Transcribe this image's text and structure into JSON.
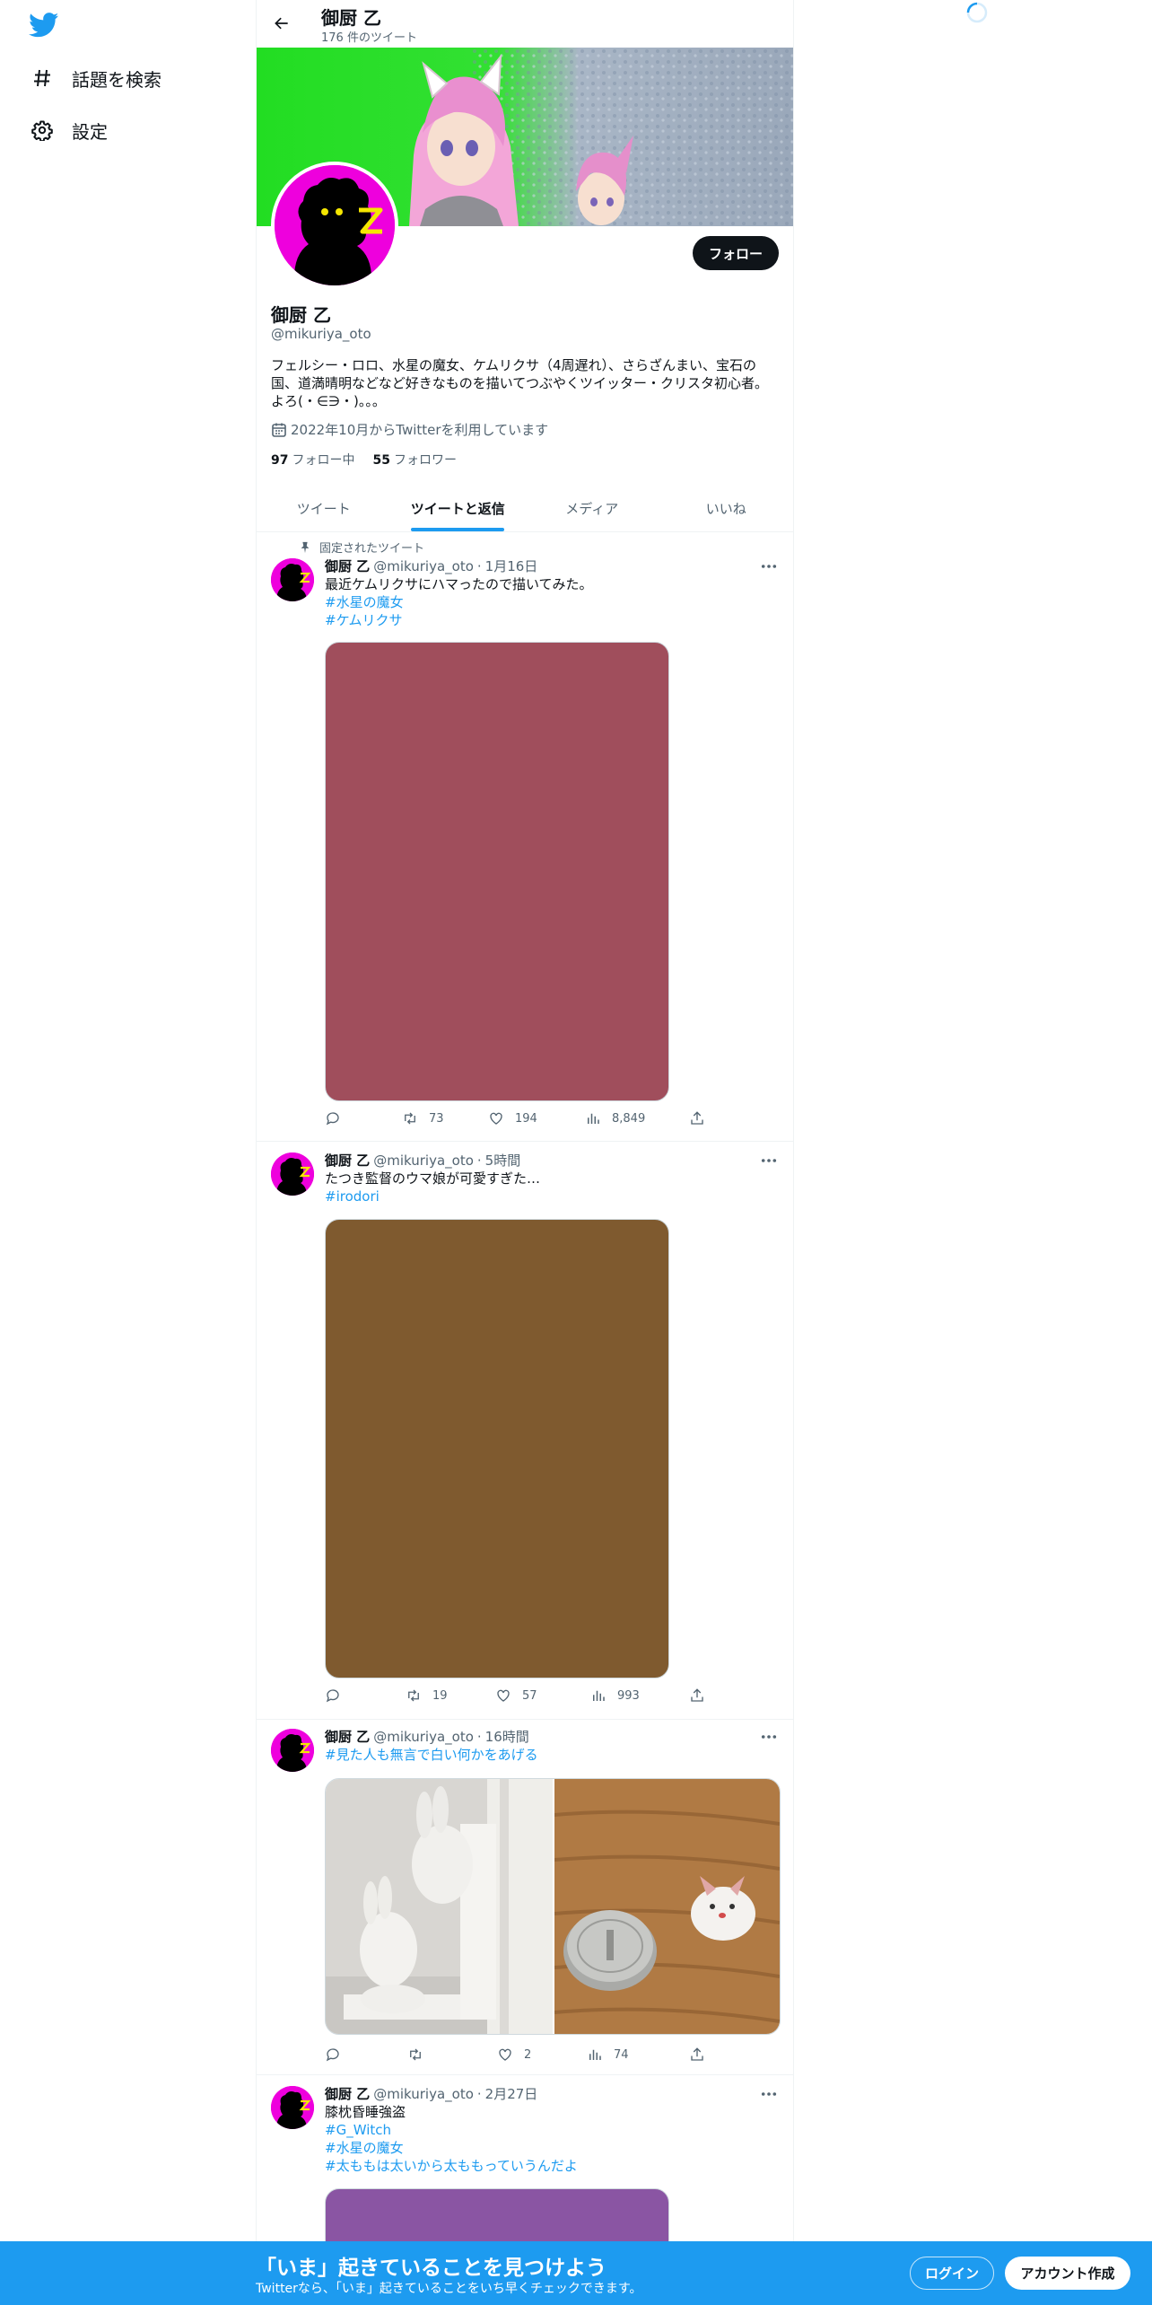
{
  "nav": {
    "items": [
      {
        "label": "話題を検索",
        "icon": "hashtag-icon"
      },
      {
        "label": "設定",
        "icon": "gear-icon"
      }
    ]
  },
  "header": {
    "title": "御厨 乙",
    "tweet_count": "176 件のツイート"
  },
  "profile": {
    "name": "御厨 乙",
    "handle": "@mikuriya_oto",
    "bio": "フェルシー・ロロ、水星の魔女、ケムリクサ（4周遅れ）、さらざんまい、宝石の国、道満晴明などなど好きなものを描いてつぶやくツイッター・クリスタ初心者。よろ(・∈∋・)。。。",
    "joined": "2022年10月からTwitterを利用しています",
    "following_count": "97",
    "following_label": "フォロー中",
    "followers_count": "55",
    "followers_label": "フォロワー",
    "follow_button": "フォロー",
    "accent_color": "#1d9bf0"
  },
  "tabs": [
    {
      "label": "ツイート",
      "active": false
    },
    {
      "label": "ツイートと返信",
      "active": true
    },
    {
      "label": "メディア",
      "active": false
    },
    {
      "label": "いいね",
      "active": false
    }
  ],
  "tweets": [
    {
      "pinned_label": "固定されたツイート",
      "name": "御厨 乙",
      "handle": "@mikuriya_oto",
      "time": "1月16日",
      "text": "最近ケムリクサにハマったので描いてみた。",
      "hashtags": [
        "#水星の魔女",
        "#ケムリクサ"
      ],
      "media_color": "#a04e5c",
      "replies": "",
      "retweets": "73",
      "likes": "194",
      "views": "8,849"
    },
    {
      "name": "御厨 乙",
      "handle": "@mikuriya_oto",
      "time": "5時間",
      "text": "たつき監督のウマ娘が可愛すぎた…",
      "hashtags": [
        "#irodori"
      ],
      "media_color": "#7f5a2f",
      "replies": "",
      "retweets": "19",
      "likes": "57",
      "views": "993"
    },
    {
      "name": "御厨 乙",
      "handle": "@mikuriya_oto",
      "time": "16時間",
      "text": "",
      "hashtags": [
        "#見た人も無言で白い何かをあげる"
      ],
      "replies": "",
      "retweets": "",
      "likes": "2",
      "views": "74"
    },
    {
      "name": "御厨 乙",
      "handle": "@mikuriya_oto",
      "time": "2月27日",
      "text": "膝枕昏睡強盗",
      "hashtags": [
        "#G_Witch",
        "#水星の魔女",
        "#太ももは太いから太ももっていうんだよ"
      ],
      "media_color": "#8a55a3"
    }
  ],
  "bottom_bar": {
    "title": "「いま」起きていることを見つけよう",
    "subtitle": "Twitterなら、「いま」起きていることをいち早くチェックできます。",
    "login": "ログイン",
    "signup": "アカウント作成"
  }
}
